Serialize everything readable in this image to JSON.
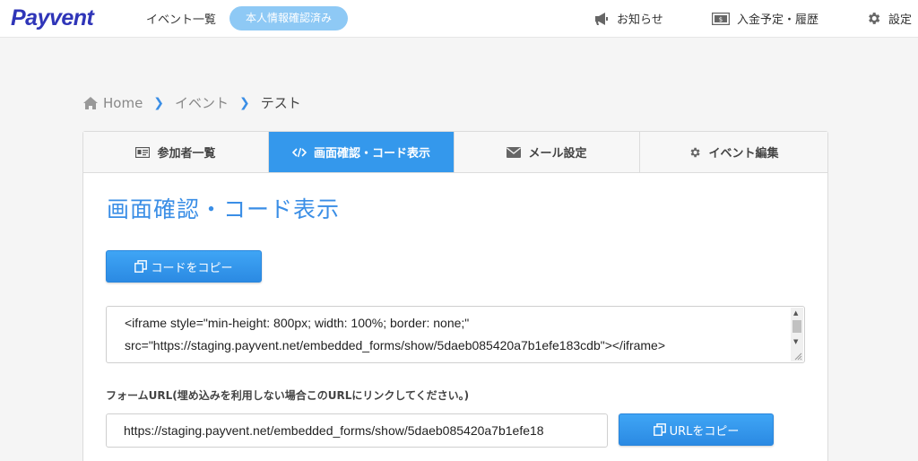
{
  "header": {
    "logo": "Payvent",
    "events_link": "イベント一覧",
    "verified_badge": "本人情報確認済み",
    "notice_link": "お知らせ",
    "payment_link": "入金予定・履歴",
    "settings_link": "設定"
  },
  "breadcrumb": {
    "home": "Home",
    "events": "イベント",
    "current": "テスト"
  },
  "tabs": [
    {
      "label": "参加者一覧",
      "icon": "id-card-icon"
    },
    {
      "label": "画面確認・コード表示",
      "icon": "code-icon",
      "active": true
    },
    {
      "label": "メール設定",
      "icon": "envelope-icon"
    },
    {
      "label": "イベント編集",
      "icon": "gear-icon"
    }
  ],
  "main": {
    "title": "画面確認・コード表示",
    "copy_code_button": "コードをコピー",
    "embed_code": "<iframe style=\"min-height: 800px; width: 100%; border: none;\"\nsrc=\"https://staging.payvent.net/embedded_forms/show/5daeb085420a7b1efe183cdb\"></iframe>",
    "form_url_label": "フォームURL(埋め込みを利用しない場合このURLにリンクしてください。)",
    "form_url_value": "https://staging.payvent.net/embedded_forms/show/5daeb085420a7b1efe18",
    "copy_url_button": "URLをコピー"
  },
  "colors": {
    "accent": "#3498ec",
    "logo": "#2f35b8",
    "badge": "#8ec9f5"
  }
}
